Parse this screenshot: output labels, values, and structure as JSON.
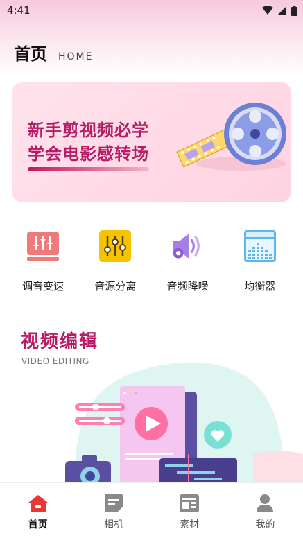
{
  "status_bar": {
    "time": "4:41"
  },
  "header": {
    "title": "首页",
    "subtitle": "HOME"
  },
  "banner": {
    "line1": "新手剪视频必学",
    "line2": "学会电影感转场"
  },
  "tools": [
    {
      "label": "调音变速",
      "icon": "equalizer-sliders-icon"
    },
    {
      "label": "音源分离",
      "icon": "mixer-icon"
    },
    {
      "label": "音频降噪",
      "icon": "speaker-icon"
    },
    {
      "label": "均衡器",
      "icon": "equalizer-bars-icon"
    }
  ],
  "section": {
    "title": "视频编辑",
    "subtitle": "VIDEO EDITING"
  },
  "tabbar": {
    "items": [
      {
        "label": "首页",
        "icon": "home-icon",
        "active": true
      },
      {
        "label": "相机",
        "icon": "camera-doc-icon",
        "active": false
      },
      {
        "label": "素材",
        "icon": "material-icon",
        "active": false
      },
      {
        "label": "我的",
        "icon": "profile-icon",
        "active": false
      }
    ]
  },
  "colors": {
    "accent": "#b71b66",
    "active_tab": "#e53935"
  }
}
